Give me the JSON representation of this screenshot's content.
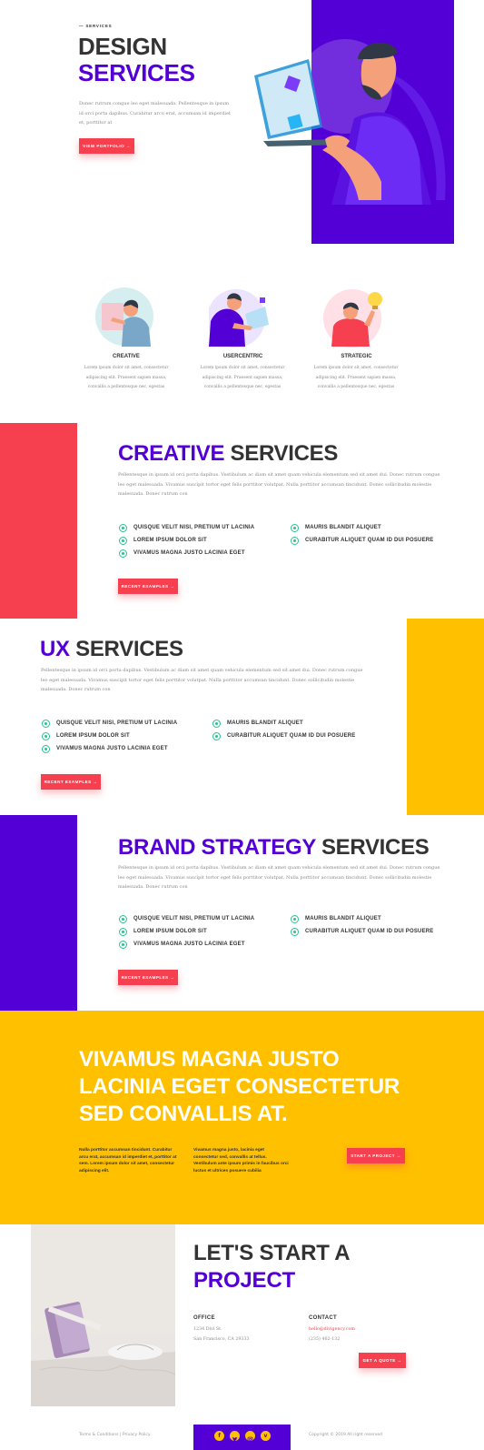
{
  "hero": {
    "eyebrow": "— SERVICES",
    "title_line1": "DESIGN",
    "title_line2": "SERVICES",
    "body": "Donec rutrum congue leo eget malesuada. Pellentesque in ipsum id orci porta dapibus. Curabitur arcu erat, accumsan id imperdiet et, porttitor at",
    "button": "VIEW PORTFOLIO →"
  },
  "features": [
    {
      "label": "CREATIVE",
      "body": "Lorem ipsum dolor sit amet, consectetur adipiscing elit. Praesent sapien massa, convallis a pellentesque nec, egestas"
    },
    {
      "label": "USERCENTRIC",
      "body": "Lorem ipsum dolor sit amet, consectetur adipiscing elit. Praesent sapien massa, convallis a pellentesque nec, egestas"
    },
    {
      "label": "STRATEGIC",
      "body": "Lorem ipsum dolor sit amet, consectetur adipiscing elit. Praesent sapien massa, convallis a pellentesque nec, egestas"
    }
  ],
  "creative": {
    "title_accent": "CREATIVE",
    "title_rest": " SERVICES",
    "body": "Pellentesque in ipsum id orci porta dapibus. Vestibulum ac diam sit amet quam vehicula elementum sed sit amet dui. Donec rutrum congue leo eget malesuada. Vivamus suscipit tortor eget felis porttitor volutpat. Nulla porttitor accumsan tincidunt. Donec sollicitudin molestie malesuada. Donec rutrum con",
    "list_left": [
      "QUISQUE VELIT NISI, PRETIUM UT LACINIA",
      "LOREM IPSUM DOLOR SIT",
      "VIVAMUS MAGNA JUSTO LACINIA EGET"
    ],
    "list_right": [
      "MAURIS BLANDIT ALIQUET",
      "CURABITUR ALIQUET QUAM ID DUI POSUERE"
    ],
    "button": "RECENT EXAMPLES →"
  },
  "ux": {
    "title_accent": "UX",
    "title_rest": " SERVICES",
    "body": "Pellentesque in ipsum id orci porta dapibus. Vestibulum ac diam sit amet quam vehicula elementum sed sit amet dui. Donec rutrum congue leo eget malesuada. Vivamus suscipit tortor eget felis porttitor volutpat. Nulla porttitor accumsan tincidunt. Donec sollicitudin molestie malesuada. Donec rutrum con",
    "list_left": [
      "QUISQUE VELIT NISI, PRETIUM UT LACINIA",
      "LOREM IPSUM DOLOR SIT",
      "VIVAMUS MAGNA JUSTO LACINIA EGET"
    ],
    "list_right": [
      "MAURIS BLANDIT ALIQUET",
      "CURABITUR ALIQUET QUAM ID DUI POSUERE"
    ],
    "button": "RECENT EXAMPLES →"
  },
  "brand": {
    "title_accent": "BRAND STRATEGY",
    "title_rest": " SERVICES",
    "body": "Pellentesque in ipsum id orci porta dapibus. Vestibulum ac diam sit amet quam vehicula elementum sed sit amet dui. Donec rutrum congue leo eget malesuada. Vivamus suscipit tortor eget felis porttitor volutpat. Nulla porttitor accumsan tincidunt. Donec sollicitudin molestie malesuada. Donec rutrum con",
    "list_left": [
      "QUISQUE VELIT NISI, PRETIUM UT LACINIA",
      "LOREM IPSUM DOLOR SIT",
      "VIVAMUS MAGNA JUSTO LACINIA EGET"
    ],
    "list_right": [
      "MAURIS BLANDIT ALIQUET",
      "CURABITUR ALIQUET QUAM ID DUI POSUERE"
    ],
    "button": "RECENT EXAMPLES →"
  },
  "cta": {
    "line1": "VIVAMUS MAGNA JUSTO",
    "line2": "LACINIA EGET CONSECTETUR",
    "line3": "SED CONVALLIS AT.",
    "col1": "Nulla porttitor accumsan tincidunt. Curabitur arcu erat, accumsan id imperdiet et, porttitor at sem. Lorem ipsum dolor sit amet, consectetur adipiscing elit.",
    "col2": "Vivamus magna justo, lacinia eget consectetur sed, convallis at tellus. Vestibulum ante ipsum primis in faucibus orci luctus et ultrices posuere cubilia",
    "button": "START A PROJECT →"
  },
  "contact": {
    "title_line1": "LET'S START A",
    "title_line2": "PROJECT",
    "office_label": "OFFICE",
    "office_addr1": "1234 Divi St.",
    "office_addr2": "San Francisco, CA 29333",
    "contact_label": "CONTACT",
    "email": "hello@divigency.com",
    "phone": "(235) 462-132",
    "button": "GET A QUOTE →"
  },
  "footer": {
    "left": "Terms & Conditions | Privacy Policy",
    "right": "Copyright © 2019 All right reserved",
    "social": [
      "f",
      "t",
      "ig",
      "v"
    ]
  },
  "colors": {
    "purple": "#5300d6",
    "red": "#f7404f",
    "yellow": "#ffc000",
    "green": "#29c28c"
  }
}
